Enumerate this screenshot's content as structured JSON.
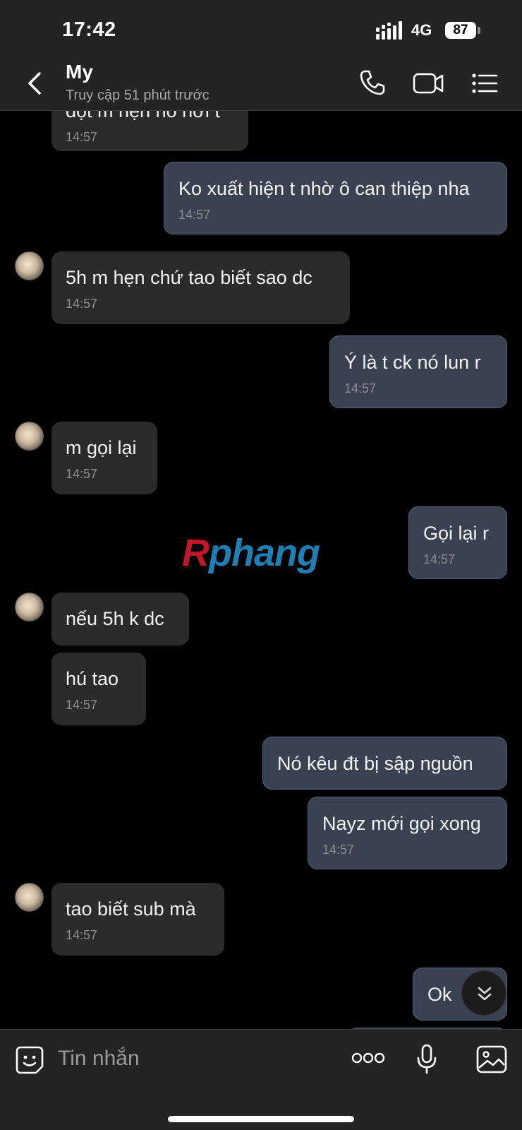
{
  "status": {
    "time": "17:42",
    "network": "4G",
    "battery": "87"
  },
  "header": {
    "name": "My",
    "last_seen": "Truy cập 51 phút trước"
  },
  "messages": [
    {
      "text": "đột m hẹn nó hơi t",
      "time": "14:57"
    },
    {
      "text": "Ko xuất hiện t nhờ ô can thiệp nha",
      "time": "14:57"
    },
    {
      "text": "5h m hẹn chứ tao biết sao dc",
      "time": "14:57"
    },
    {
      "text": "Ý là t ck nó lun r",
      "time": "14:57"
    },
    {
      "text": "m gọi lại",
      "time": "14:57"
    },
    {
      "text": "Gọi lại r",
      "time": "14:57"
    },
    {
      "text": "nếu 5h k dc"
    },
    {
      "text": "hú tao",
      "time": "14:57"
    },
    {
      "text": "Nó kêu đt bị sập nguồn"
    },
    {
      "text": "Nayz mới gọi xong",
      "time": "14:57"
    },
    {
      "text": "tao biết sub mà",
      "time": "14:57"
    },
    {
      "text": "Ok"
    }
  ],
  "watermark": {
    "first": "R",
    "rest": "phang"
  },
  "composer": {
    "placeholder": "Tin nhắn"
  },
  "icons": {
    "back": "chevron-left-icon",
    "call": "phone-icon",
    "video": "video-camera-icon",
    "menu": "list-menu-icon",
    "sticker": "smiley-sticker-icon",
    "more": "more-dots-icon",
    "mic": "microphone-icon",
    "image": "image-gallery-icon",
    "scroll": "double-chevron-down-icon"
  },
  "colors": {
    "incoming_bubble": "#2b2b2b",
    "outgoing_bubble": "#3a4150",
    "header_bg": "#242424",
    "background": "#000000"
  }
}
